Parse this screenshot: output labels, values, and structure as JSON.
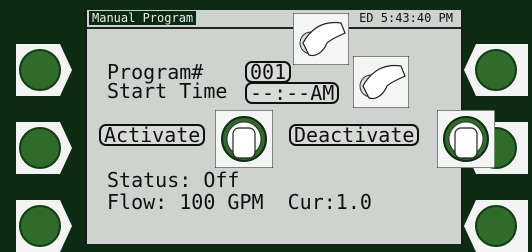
{
  "header": {
    "title": "Manual Program",
    "clock": "ED 5:43:40 PM"
  },
  "form": {
    "program_label": "Program#",
    "program_value": "001",
    "start_label": "Start Time",
    "start_value": "--:--AM"
  },
  "actions": {
    "activate": "Activate",
    "deactivate": "Deactivate"
  },
  "status": {
    "status_line": "Status: Off",
    "flow_line": "Flow: 100 GPM  Cur:1.0"
  },
  "colors": {
    "bezel": "#0d2a12",
    "screen": "#cfd3cf",
    "softkey": "#2f6b2b"
  },
  "icons": [
    "hand-gesture-icon",
    "touch-button-icon",
    "softkey-arrow-icon"
  ]
}
